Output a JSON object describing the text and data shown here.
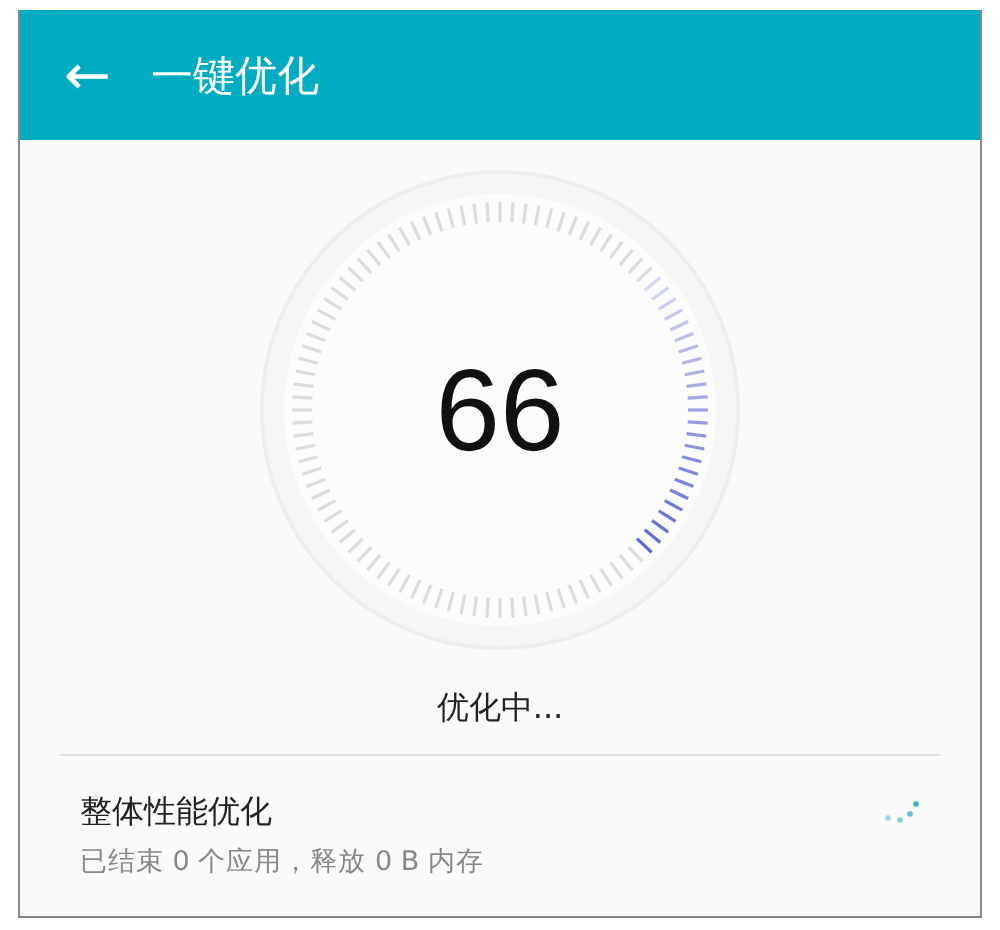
{
  "header": {
    "back_icon": "←",
    "title": "一键优化"
  },
  "gauge": {
    "score": "66"
  },
  "status": "优化中...",
  "task": {
    "title": "整体性能优化",
    "detail": "已结束 0 个应用，释放 0 B 内存",
    "loading": true
  }
}
